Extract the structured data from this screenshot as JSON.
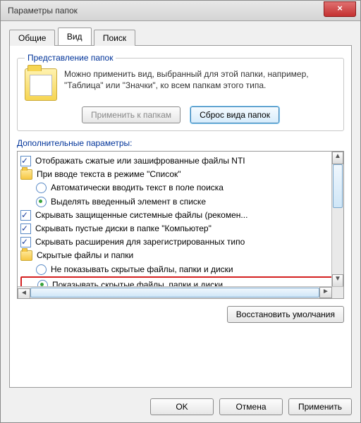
{
  "window": {
    "title": "Параметры папок"
  },
  "close_glyph": "×",
  "tabs": {
    "general": "Общие",
    "view": "Вид",
    "search": "Поиск"
  },
  "group": {
    "legend": "Представление папок",
    "description": "Можно применить вид, выбранный для этой папки, например, \"Таблица\" или \"Значки\", ко всем папкам этого типа.",
    "apply_button": "Применить к папкам",
    "reset_button": "Сброс вида папок"
  },
  "advanced": {
    "label": "Дополнительные параметры:",
    "items": [
      {
        "type": "checkbox",
        "checked": true,
        "label": "Отображать сжатые или зашифрованные файлы NTI"
      },
      {
        "type": "folder",
        "label": "При вводе текста в режиме \"Список\""
      },
      {
        "type": "radio",
        "checked": false,
        "indent": true,
        "label": "Автоматически вводить текст в поле поиска"
      },
      {
        "type": "radio",
        "checked": true,
        "indent": true,
        "label": "Выделять введенный элемент в списке"
      },
      {
        "type": "checkbox",
        "checked": true,
        "label": "Скрывать защищенные системные файлы (рекомен..."
      },
      {
        "type": "checkbox",
        "checked": true,
        "label": "Скрывать пустые диски в папке \"Компьютер\""
      },
      {
        "type": "checkbox",
        "checked": true,
        "label": "Скрывать расширения для зарегистрированных типо"
      },
      {
        "type": "folder",
        "label": "Скрытые файлы и папки"
      },
      {
        "type": "radio",
        "checked": false,
        "indent": true,
        "label": "Не показывать скрытые файлы, папки и диски"
      },
      {
        "type": "radio",
        "checked": true,
        "indent": true,
        "highlight": true,
        "label": "Показывать скрытые файлы, папки и диски"
      }
    ]
  },
  "restore_defaults": "Восстановить умолчания",
  "buttons": {
    "ok": "OK",
    "cancel": "Отмена",
    "apply": "Применить"
  },
  "scroll": {
    "up": "▲",
    "down": "▼",
    "left": "◄",
    "right": "►"
  }
}
